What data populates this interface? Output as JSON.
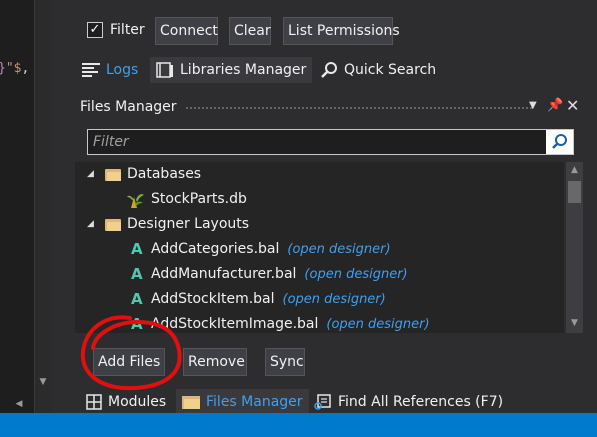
{
  "editor": {
    "code_fragment": {
      "brace": "}",
      "quote": "\"$",
      "separator": ","
    }
  },
  "toolbar": {
    "filter_checked": true,
    "filter_label": "Filter",
    "connect_label": "Connect",
    "clear_label": "Clear",
    "list_permissions_label": "List Permissions"
  },
  "top_tabs": [
    {
      "label": "Logs",
      "icon": "lines-icon",
      "active": true
    },
    {
      "label": "Libraries Manager",
      "icon": "book-icon",
      "active": false
    },
    {
      "label": "Quick Search",
      "icon": "magnifier-icon",
      "active": false
    }
  ],
  "files_manager": {
    "title": "Files Manager",
    "filter_placeholder": "Filter",
    "filter_value": "",
    "tree": [
      {
        "type": "folder",
        "label": "Databases",
        "expanded": true,
        "level": 0
      },
      {
        "type": "db",
        "label": "StockParts.db",
        "level": 1
      },
      {
        "type": "folder",
        "label": "Designer Layouts",
        "expanded": true,
        "level": 0
      },
      {
        "type": "layout",
        "label": "AddCategories.bal",
        "link": "(open designer)",
        "level": 1
      },
      {
        "type": "layout",
        "label": "AddManufacturer.bal",
        "link": "(open designer)",
        "level": 1
      },
      {
        "type": "layout",
        "label": "AddStockItem.bal",
        "link": "(open designer)",
        "level": 1
      },
      {
        "type": "layout",
        "label": "AddStockItemImage.bal",
        "link": "(open designer)",
        "level": 1
      }
    ],
    "buttons": {
      "add_files": "Add Files",
      "remove": "Remove",
      "sync": "Sync"
    }
  },
  "bottom_tabs": [
    {
      "label": "Modules",
      "icon": "grid-icon",
      "active": false
    },
    {
      "label": "Files Manager",
      "icon": "folder-icon",
      "active": true
    },
    {
      "label": "Find All References (F7)",
      "icon": "references-icon",
      "active": false
    }
  ],
  "colors": {
    "background": "#2d2d30",
    "accent": "#3ea0f0",
    "status_bar": "#007acc",
    "layout_icon": "#4ec9b0",
    "annotation": "#e01010"
  }
}
